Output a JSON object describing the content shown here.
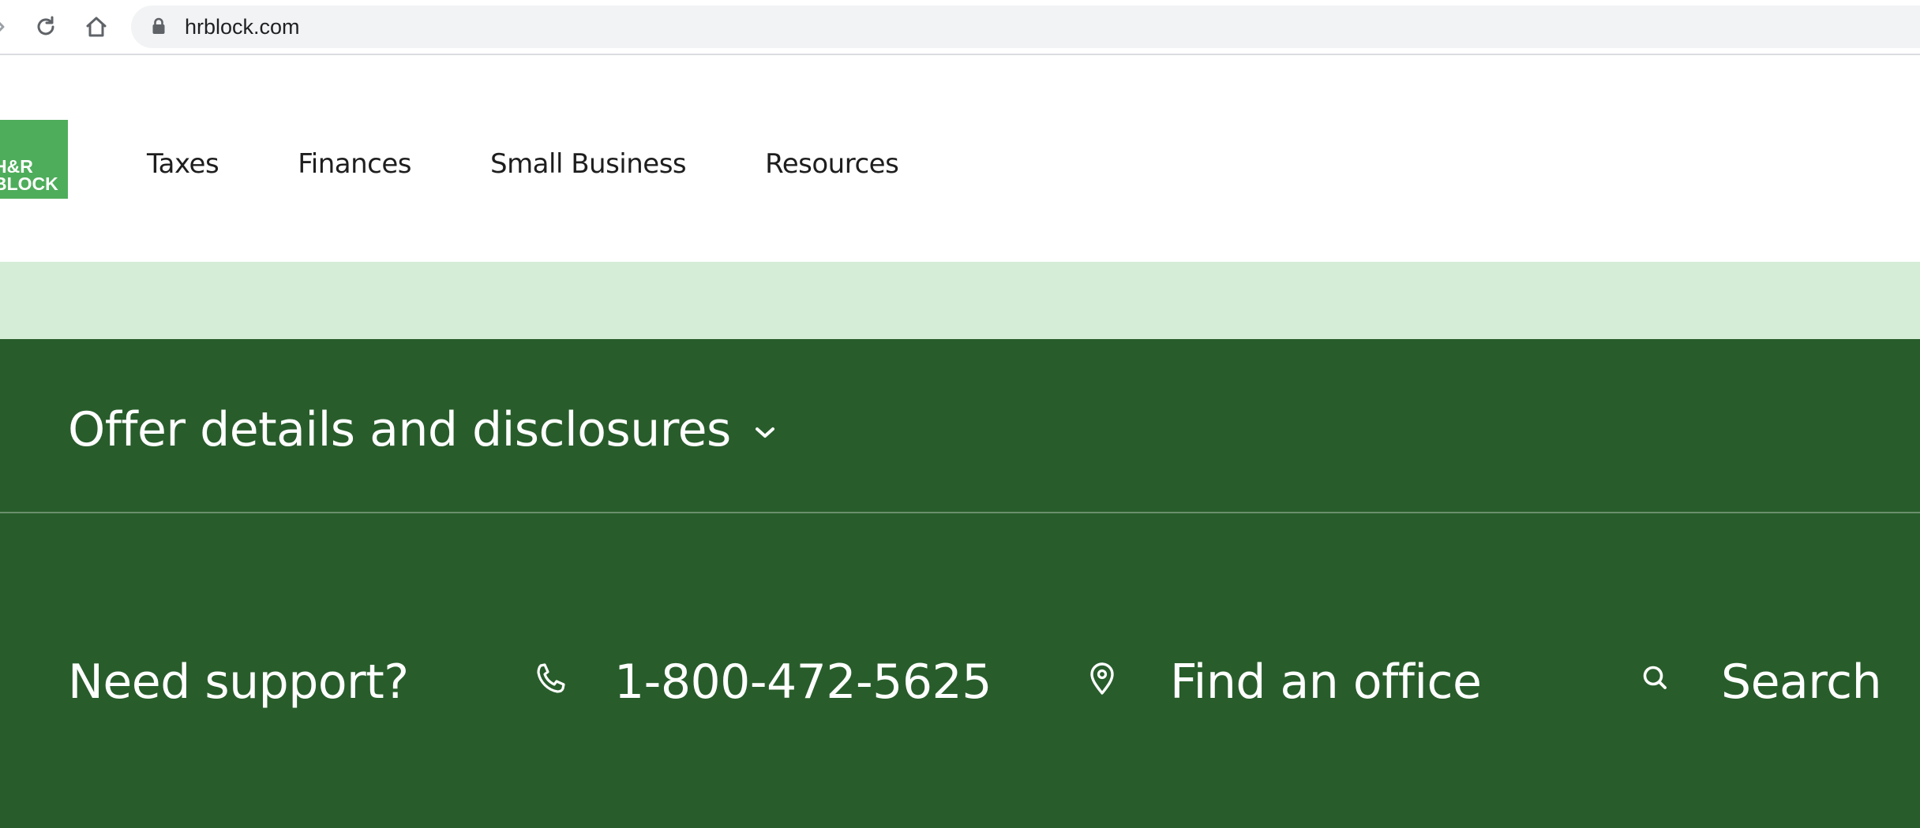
{
  "browser": {
    "url": "hrblock.com",
    "icons": [
      "forward-icon",
      "reload-icon",
      "home-icon",
      "lock-icon"
    ]
  },
  "header": {
    "logo": {
      "text_line1": "H&R",
      "text_line2": "BLOCK",
      "color": "#4ead5b"
    },
    "nav": [
      {
        "label": "Taxes"
      },
      {
        "label": "Finances"
      },
      {
        "label": "Small Business"
      },
      {
        "label": "Resources"
      }
    ]
  },
  "promo_band": {
    "color": "#d5ecd7"
  },
  "footer": {
    "background": "#285d2b",
    "disclosure": {
      "label": "Offer details and disclosures",
      "icon": "chevron-down-icon",
      "expanded": false
    },
    "support": {
      "label": "Need support?",
      "links": [
        {
          "icon": "phone-icon",
          "label": "1-800-472-5625"
        },
        {
          "icon": "location-pin-icon",
          "label": "Find an office"
        },
        {
          "icon": "search-icon",
          "label": "Search"
        }
      ]
    }
  }
}
